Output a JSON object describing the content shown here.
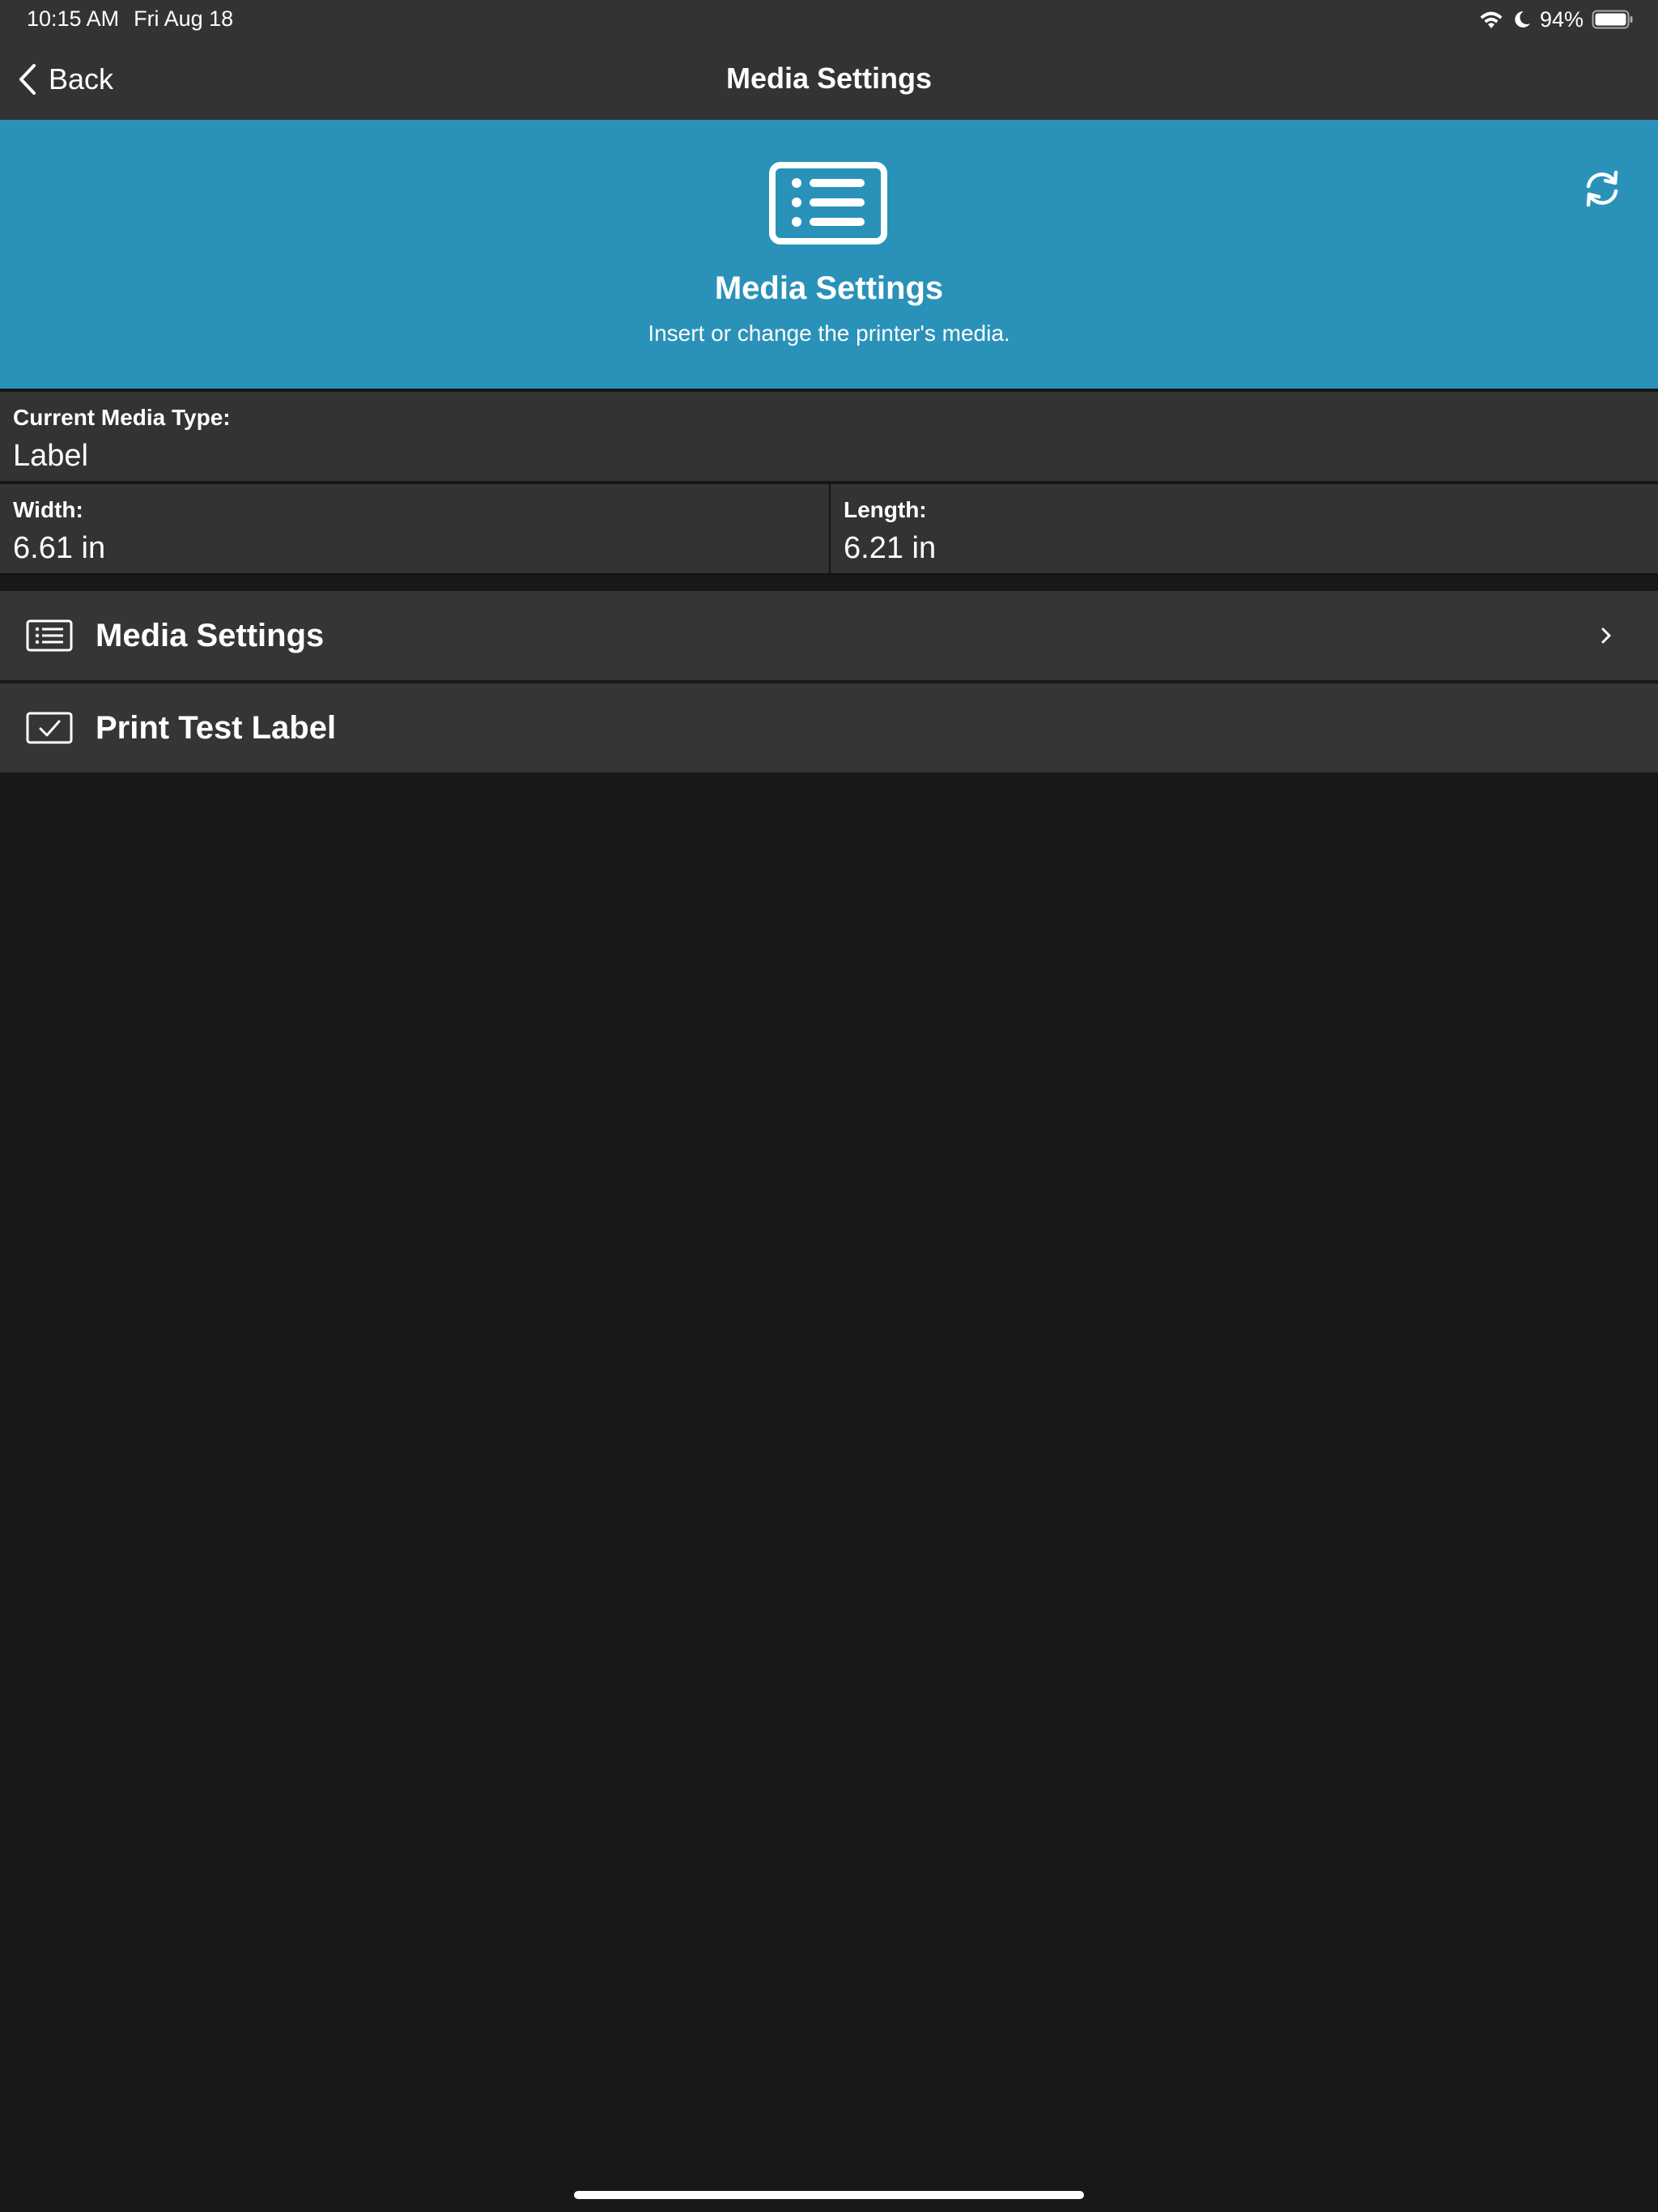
{
  "status_bar": {
    "time": "10:15 AM",
    "date": "Fri Aug 18",
    "battery": "94%",
    "icons": [
      "wifi-icon",
      "moon-icon",
      "battery-icon"
    ]
  },
  "nav": {
    "back_label": "Back",
    "title": "Media Settings"
  },
  "hero": {
    "title": "Media Settings",
    "subtitle": "Insert or change the printer's media.",
    "icon": "list-card-icon",
    "action_icon": "refresh-icon",
    "background": "#2a92b9"
  },
  "media": {
    "type_label": "Current Media Type:",
    "type_value": "Label",
    "width_label": "Width:",
    "width_value": "6.61 in",
    "length_label": "Length:",
    "length_value": "6.21 in"
  },
  "menu": {
    "items": [
      {
        "label": "Media Settings",
        "icon": "list-icon",
        "has_chevron": true
      },
      {
        "label": "Print Test Label",
        "icon": "checkbox-label-icon",
        "has_chevron": false
      }
    ]
  }
}
